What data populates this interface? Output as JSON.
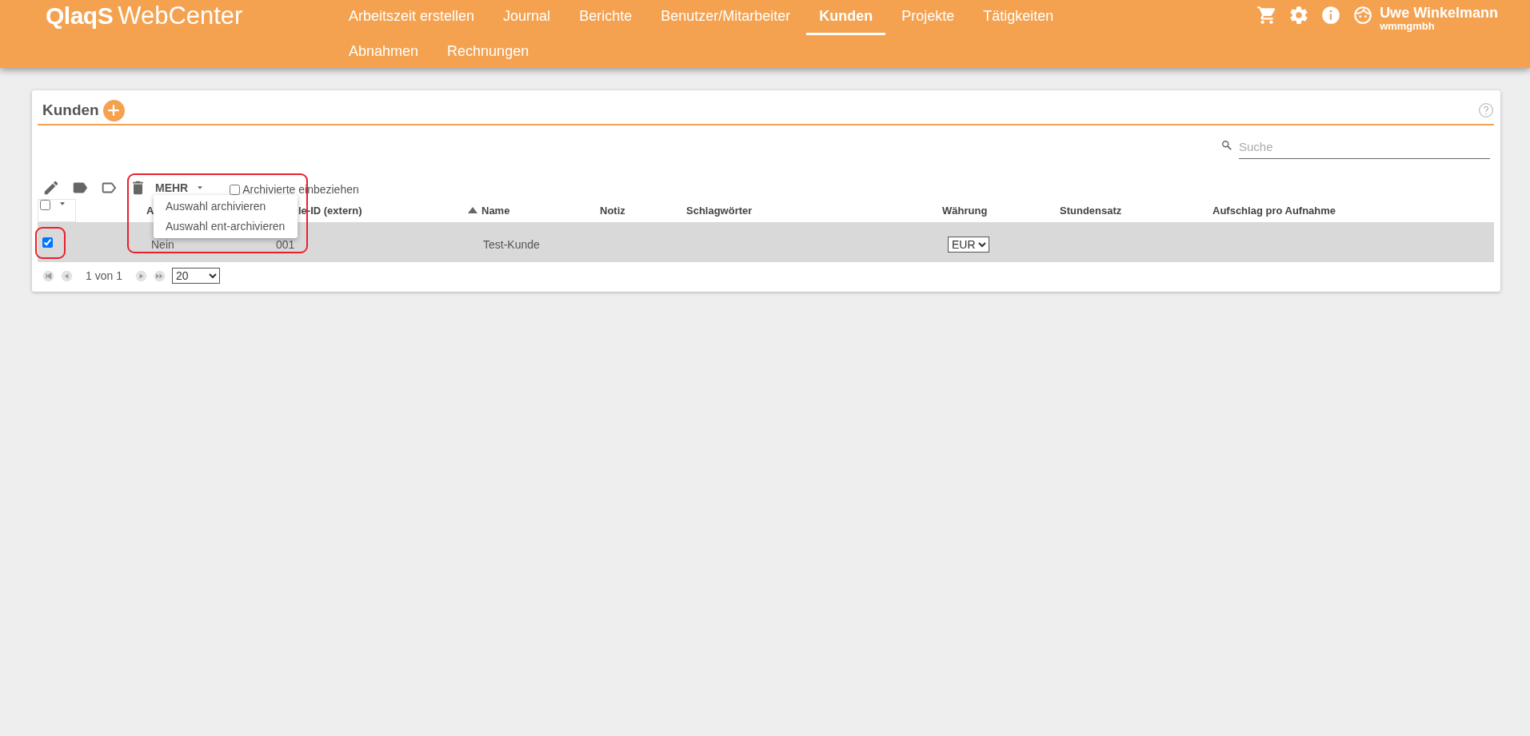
{
  "header": {
    "logo": {
      "brand": "QlaqS",
      "product": "WebCenter"
    },
    "nav": [
      {
        "label": "Arbeitszeit erstellen",
        "selected": false
      },
      {
        "label": "Journal",
        "selected": false
      },
      {
        "label": "Berichte",
        "selected": false
      },
      {
        "label": "Benutzer/Mitarbeiter",
        "selected": false
      },
      {
        "label": "Kunden",
        "selected": true
      },
      {
        "label": "Projekte",
        "selected": false
      },
      {
        "label": "Tätigkeiten",
        "selected": false
      },
      {
        "label": "Abnahmen",
        "selected": false
      },
      {
        "label": "Rechnungen",
        "selected": false
      }
    ],
    "user": {
      "name": "Uwe Winkelmann",
      "company": "wmmgmbh"
    }
  },
  "panel": {
    "title": "Kunden",
    "search": {
      "placeholder": "Suche"
    },
    "toolbar": {
      "more_label": "MEHR",
      "include_archived": {
        "label": "Archivierte einbeziehen",
        "checked": false
      }
    },
    "more_menu": {
      "open": true,
      "items": [
        "Auswahl archivieren",
        "Auswahl ent-archivieren"
      ]
    },
    "select_all": {
      "checked": false
    },
    "columns": [
      {
        "label": "A"
      },
      {
        "label": "le-ID (extern)"
      },
      {
        "label": "Name",
        "sorted": true
      },
      {
        "label": "Notiz"
      },
      {
        "label": "Schlagwörter"
      },
      {
        "label": "Währung"
      },
      {
        "label": "Stundensatz"
      },
      {
        "label": "Aufschlag pro Aufnahme"
      }
    ],
    "rows": [
      {
        "selected": true,
        "archived": "Nein",
        "id": "001",
        "name": "Test-Kunde",
        "currency": "EUR"
      }
    ],
    "pager": {
      "text": "1 von 1",
      "page_size": "20"
    }
  }
}
